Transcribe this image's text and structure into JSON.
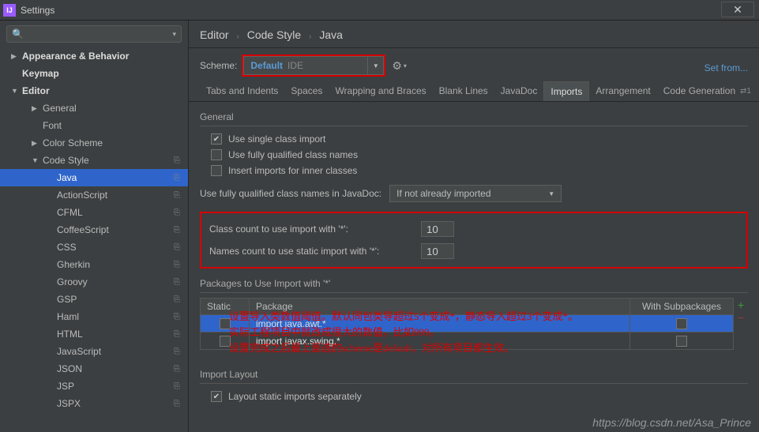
{
  "window": {
    "title": "Settings"
  },
  "sidebar": {
    "search_placeholder": "",
    "items": [
      {
        "label": "Appearance & Behavior",
        "arrow": "▶",
        "bold": true,
        "lvl": 1
      },
      {
        "label": "Keymap",
        "arrow": "",
        "bold": true,
        "lvl": 1
      },
      {
        "label": "Editor",
        "arrow": "▼",
        "bold": true,
        "lvl": 1
      },
      {
        "label": "General",
        "arrow": "▶",
        "lvl": 2
      },
      {
        "label": "Font",
        "arrow": "",
        "lvl": 2
      },
      {
        "label": "Color Scheme",
        "arrow": "▶",
        "lvl": 2
      },
      {
        "label": "Code Style",
        "arrow": "▼",
        "lvl": 2,
        "cfg": true
      },
      {
        "label": "Java",
        "arrow": "",
        "lvl": 3,
        "selected": true,
        "cfg": true
      },
      {
        "label": "ActionScript",
        "arrow": "",
        "lvl": 3,
        "cfg": true
      },
      {
        "label": "CFML",
        "arrow": "",
        "lvl": 3,
        "cfg": true
      },
      {
        "label": "CoffeeScript",
        "arrow": "",
        "lvl": 3,
        "cfg": true
      },
      {
        "label": "CSS",
        "arrow": "",
        "lvl": 3,
        "cfg": true
      },
      {
        "label": "Gherkin",
        "arrow": "",
        "lvl": 3,
        "cfg": true
      },
      {
        "label": "Groovy",
        "arrow": "",
        "lvl": 3,
        "cfg": true
      },
      {
        "label": "GSP",
        "arrow": "",
        "lvl": 3,
        "cfg": true
      },
      {
        "label": "Haml",
        "arrow": "",
        "lvl": 3,
        "cfg": true
      },
      {
        "label": "HTML",
        "arrow": "",
        "lvl": 3,
        "cfg": true
      },
      {
        "label": "JavaScript",
        "arrow": "",
        "lvl": 3,
        "cfg": true
      },
      {
        "label": "JSON",
        "arrow": "",
        "lvl": 3,
        "cfg": true
      },
      {
        "label": "JSP",
        "arrow": "",
        "lvl": 3,
        "cfg": true
      },
      {
        "label": "JSPX",
        "arrow": "",
        "lvl": 3,
        "cfg": true
      }
    ]
  },
  "breadcrumb": {
    "p1": "Editor",
    "p2": "Code Style",
    "p3": "Java"
  },
  "scheme": {
    "label": "Scheme:",
    "value": "Default",
    "scope": "IDE",
    "setfrom": "Set from..."
  },
  "tabs": [
    "Tabs and Indents",
    "Spaces",
    "Wrapping and Braces",
    "Blank Lines",
    "JavaDoc",
    "Imports",
    "Arrangement",
    "Code Generation"
  ],
  "tabs_active": 5,
  "tabs_extra": "⇄1",
  "general": {
    "title": "General",
    "c1": "Use single class import",
    "c2": "Use fully qualified class names",
    "c3": "Insert imports for inner classes"
  },
  "qual": {
    "label": "Use fully qualified class names in JavaDoc:",
    "value": "If not already imported"
  },
  "counts": {
    "l1": "Class count to use import with '*':",
    "v1": "10",
    "l2": "Names count to use static import with '*':",
    "v2": "10"
  },
  "pkg": {
    "title": "Packages to Use Import with '*'",
    "h_static": "Static",
    "h_pkg": "Package",
    "h_sub": "With Subpackages",
    "rows": [
      {
        "pkg": "import java.awt.*",
        "sel": true
      },
      {
        "pkg": "import javax.swing.*",
        "sel": false
      }
    ]
  },
  "layout": {
    "title": "Import Layout",
    "c1": "Layout static imports separately"
  },
  "overlay": {
    "l1": "设置导入类数值阈值。默认同包类导超过5个变成*，静态导入超过3个变成*。",
    "l2": "实际工程项目中就改成很大的数值，比如999。",
    "l3": "设置完成之后最上面选的scheme是default，对所有项目都生效。"
  },
  "watermark": "https://blog.csdn.net/Asa_Prince"
}
